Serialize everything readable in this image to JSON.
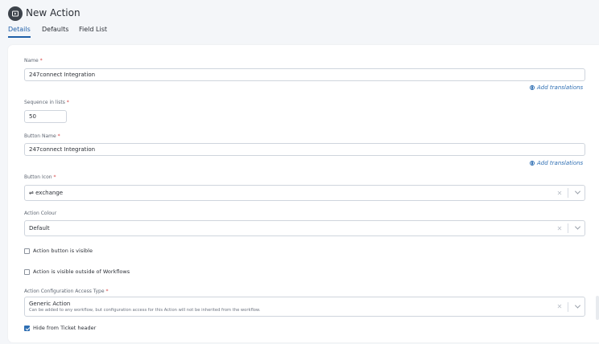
{
  "header": {
    "title": "New Action",
    "icon": "play-square-icon",
    "tabs": [
      {
        "label": "Details",
        "active": true
      },
      {
        "label": "Defaults",
        "active": false
      },
      {
        "label": "Field List",
        "active": false
      }
    ]
  },
  "form": {
    "name": {
      "label": "Name",
      "required_mark": "*",
      "value": "247connect Integration"
    },
    "add_translations": "Add translations",
    "sequence": {
      "label": "Sequence in lists",
      "required_mark": "*",
      "value": "50"
    },
    "button_name": {
      "label": "Button Name",
      "required_mark": "*",
      "value": "247connect Integration"
    },
    "button_icon": {
      "label": "Button Icon",
      "required_mark": "*",
      "glyph": "⇌",
      "value": "exchange"
    },
    "action_colour": {
      "label": "Action Colour",
      "value": "Default"
    },
    "checkboxes": {
      "visible": {
        "label": "Action button is visible",
        "checked": false
      },
      "outside_workflows": {
        "label": "Action is visible outside of Workflows",
        "checked": false
      }
    },
    "access_type": {
      "label": "Action Configuration Access Type",
      "required_mark": "*",
      "value": "Generic Action",
      "description": "Can be added to any workflow, but configuration access for this Action will not be inherited from the workflow."
    },
    "hide_header": {
      "label": "Hide from Ticket header",
      "checked": true
    }
  },
  "colors": {
    "accent": "#1f5fa8",
    "link": "#2f6fb3",
    "required": "#d64545"
  }
}
